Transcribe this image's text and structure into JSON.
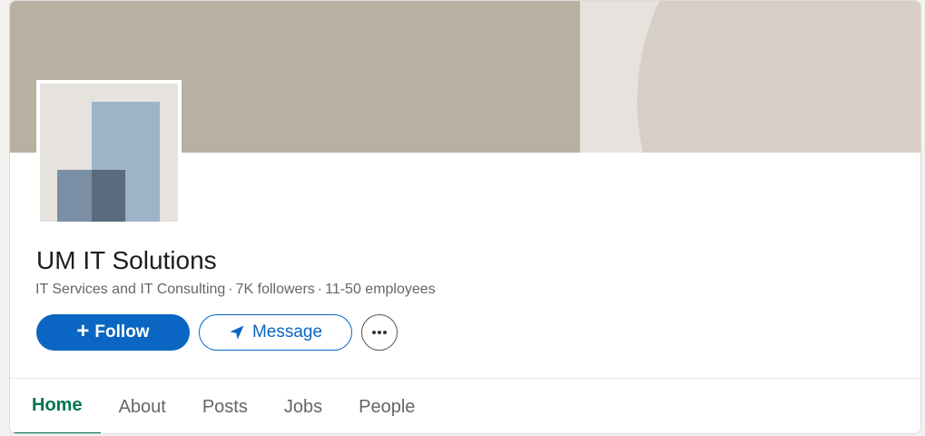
{
  "company": {
    "name": "UM IT Solutions",
    "industry": "IT Services and IT Consulting",
    "followers": "7K followers",
    "employees": "11-50 employees",
    "separator": "·"
  },
  "actions": {
    "follow_label": "Follow",
    "follow_icon": "plus-icon",
    "message_label": "Message",
    "message_icon": "send-icon",
    "more_icon": "ellipsis-icon"
  },
  "tabs": [
    {
      "label": "Home",
      "active": true
    },
    {
      "label": "About",
      "active": false
    },
    {
      "label": "Posts",
      "active": false
    },
    {
      "label": "Jobs",
      "active": false
    },
    {
      "label": "People",
      "active": false
    }
  ],
  "colors": {
    "primary": "#0a66c2",
    "active_tab": "#01754f",
    "cover": "#b8b0a0",
    "cover_accent": "#d7cfc5"
  }
}
